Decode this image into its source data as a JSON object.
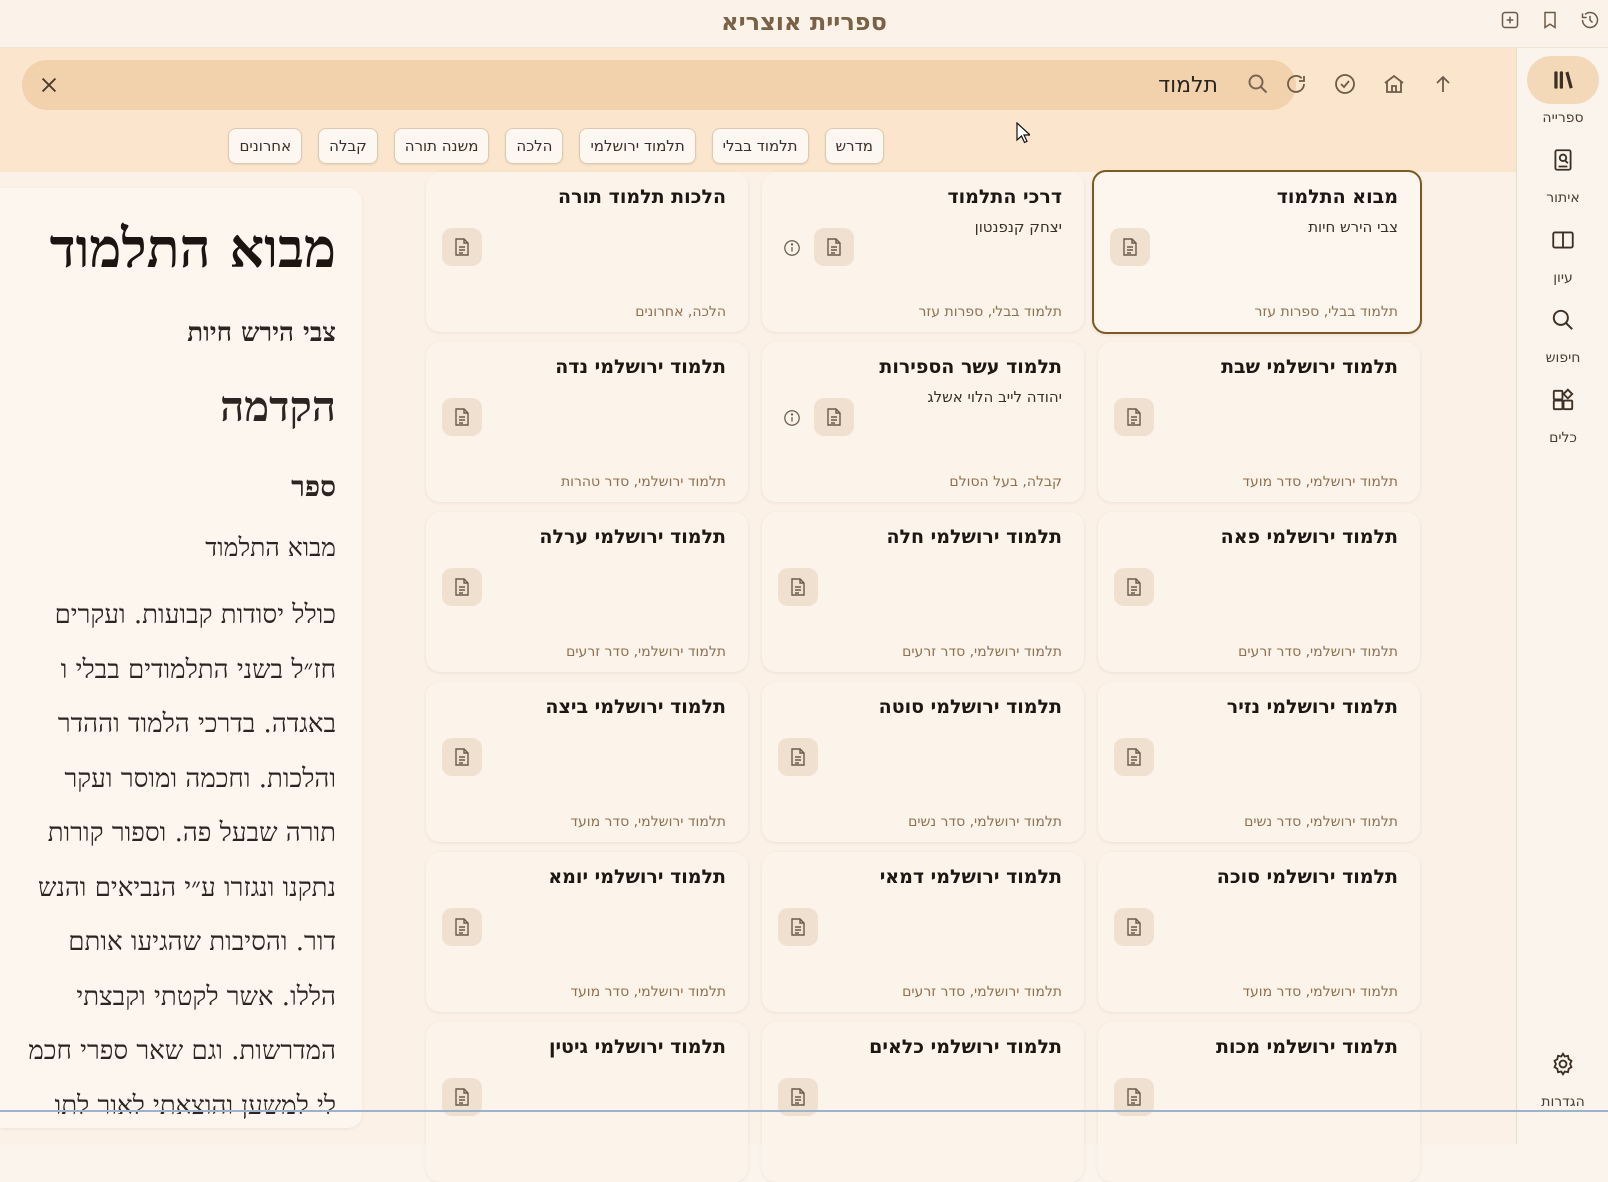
{
  "app": {
    "title": "ספריית אוצריא"
  },
  "titlebar_icons": [
    "new-tab-icon",
    "bookmark-icon",
    "history-icon"
  ],
  "rail": {
    "items": [
      {
        "label": "ספרייה",
        "icon": "library-icon",
        "active": true
      },
      {
        "label": "איתור",
        "icon": "find-book-icon"
      },
      {
        "label": "עיון",
        "icon": "book-open-icon"
      },
      {
        "label": "חיפוש",
        "icon": "search-icon"
      },
      {
        "label": "כלים",
        "icon": "tools-icon"
      }
    ],
    "settings_label": "הגדרות"
  },
  "search": {
    "value": "תלמוד",
    "placeholder": ""
  },
  "nav": [
    "up-arrow-icon",
    "home-icon",
    "check-circle-icon",
    "refresh-icon"
  ],
  "chips": [
    "אחרונים",
    "קבלה",
    "משנה תורה",
    "הלכה",
    "תלמוד ירושלמי",
    "תלמוד בבלי",
    "מדרש"
  ],
  "preview": {
    "title": "מבוא התלמוד",
    "author": "צבי הירש חיות",
    "heading": "הקדמה",
    "subheading": "ספר",
    "book_name": "מבוא התלמוד",
    "body_lines": [
      "כולל יסודות קבועות. ועקרים",
      "חז״ל בשני התלמודים בבלי ו",
      "באגדה. בדרכי הלמוד וההדר",
      "והלכות. וחכמה ומוסר ועקר",
      "תורה שבעל פה. וספור קורות",
      "נתקנו ונגזרו ע״י הנביאים והנש",
      "דור. והסיבות שהגיעו אותם",
      "הללו. אשר לקטתי וקבצתי",
      "המדרשות. וגם שאר ספרי חכמ",
      "לי למשען והוצאתי לאור לתו"
    ]
  },
  "cards": [
    {
      "title": "מבוא התלמוד",
      "author": "צבי הירש חיות",
      "categories": "תלמוד בבלי, ספרות עזר",
      "selected": true,
      "info": false
    },
    {
      "title": "דרכי התלמוד",
      "author": "יצחק קנפנטון",
      "categories": "תלמוד בבלי, ספרות עזר",
      "info": true
    },
    {
      "title": "הלכות תלמוד תורה",
      "author": "",
      "categories": "הלכה, אחרונים",
      "info": false
    },
    {
      "title": "תלמוד ירושלמי שבת",
      "author": "",
      "categories": "תלמוד ירושלמי, סדר מועד",
      "info": false
    },
    {
      "title": "תלמוד עשר הספירות",
      "author": "יהודה לייב הלוי אשלג",
      "categories": "קבלה, בעל הסולם",
      "info": true
    },
    {
      "title": "תלמוד ירושלמי נדה",
      "author": "",
      "categories": "תלמוד ירושלמי, סדר טהרות",
      "info": false
    },
    {
      "title": "תלמוד ירושלמי פאה",
      "author": "",
      "categories": "תלמוד ירושלמי, סדר זרעים",
      "info": false
    },
    {
      "title": "תלמוד ירושלמי חלה",
      "author": "",
      "categories": "תלמוד ירושלמי, סדר זרעים",
      "info": false
    },
    {
      "title": "תלמוד ירושלמי ערלה",
      "author": "",
      "categories": "תלמוד ירושלמי, סדר זרעים",
      "info": false
    },
    {
      "title": "תלמוד ירושלמי נזיר",
      "author": "",
      "categories": "תלמוד ירושלמי, סדר נשים",
      "info": false
    },
    {
      "title": "תלמוד ירושלמי סוטה",
      "author": "",
      "categories": "תלמוד ירושלמי, סדר נשים",
      "info": false
    },
    {
      "title": "תלמוד ירושלמי ביצה",
      "author": "",
      "categories": "תלמוד ירושלמי, סדר מועד",
      "info": false
    },
    {
      "title": "תלמוד ירושלמי סוכה",
      "author": "",
      "categories": "תלמוד ירושלמי, סדר מועד",
      "info": false
    },
    {
      "title": "תלמוד ירושלמי דמאי",
      "author": "",
      "categories": "תלמוד ירושלמי, סדר זרעים",
      "info": false
    },
    {
      "title": "תלמוד ירושלמי יומא",
      "author": "",
      "categories": "תלמוד ירושלמי, סדר מועד",
      "info": false
    },
    {
      "title": "תלמוד ירושלמי מכות",
      "author": "",
      "categories": "",
      "info": false
    },
    {
      "title": "תלמוד ירושלמי כלאים",
      "author": "",
      "categories": "",
      "info": false
    },
    {
      "title": "תלמוד ירושלמי גיטין",
      "author": "",
      "categories": "",
      "info": false
    }
  ]
}
